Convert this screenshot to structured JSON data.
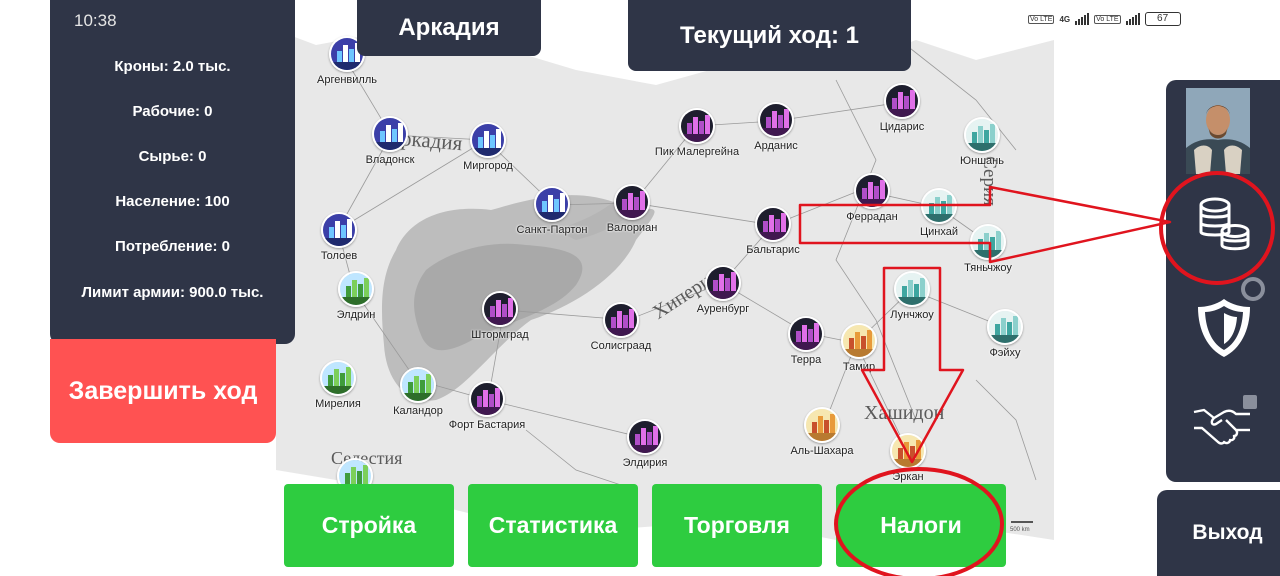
{
  "status_bar": {
    "time": "10:38",
    "sim1_label": "Vo LTE",
    "network": "4G",
    "sim2_label": "Vo LTE",
    "battery": "67"
  },
  "stats": {
    "crowns": "Кроны: 2.0 тыс.",
    "workers": "Рабочие: 0",
    "raw": "Сырье: 0",
    "population": "Население: 100",
    "consumption": "Потребление: 0",
    "army_limit": "Лимит армии: 900.0 тыс."
  },
  "end_turn_label": "Завершить ход",
  "country_name": "Аркадия",
  "turn_label": "Текущий ход: 1",
  "exit_label": "Выход",
  "bottom_buttons": {
    "build": "Стройка",
    "stats": "Статистика",
    "trade": "Торговля",
    "taxes": "Налоги"
  },
  "side_panel": {
    "avatar_icon": "leader-portrait",
    "finance_icon": "coins-stack-icon",
    "defense_icon": "shield-icon",
    "diplomacy_icon": "handshake-icon"
  },
  "regions": {
    "arcadia": "Аркадия",
    "hyperion": "Хиперион",
    "hashidon": "Хашидон",
    "selestia": "Селестия",
    "seria": "Серия"
  },
  "scale_label": "500 km",
  "cities": [
    {
      "name": "Аргенвилль",
      "style": "blue"
    },
    {
      "name": "Владонск",
      "style": "blue"
    },
    {
      "name": "Миргород",
      "style": "blue"
    },
    {
      "name": "Толоев",
      "style": "blue"
    },
    {
      "name": "Санкт-Партон",
      "style": "blue"
    },
    {
      "name": "Валориан",
      "style": "purple"
    },
    {
      "name": "Пик Малергейна",
      "style": "purple"
    },
    {
      "name": "Арданис",
      "style": "purple"
    },
    {
      "name": "Цидарис",
      "style": "purple"
    },
    {
      "name": "Юншань",
      "style": "teal"
    },
    {
      "name": "Феррадан",
      "style": "purple"
    },
    {
      "name": "Цинхай",
      "style": "teal"
    },
    {
      "name": "Бальтарис",
      "style": "purple"
    },
    {
      "name": "Тяньчжоу",
      "style": "teal"
    },
    {
      "name": "Элдрин",
      "style": "green"
    },
    {
      "name": "Штормград",
      "style": "purple"
    },
    {
      "name": "Солисграад",
      "style": "purple"
    },
    {
      "name": "Ауренбург",
      "style": "purple"
    },
    {
      "name": "Лунчжоу",
      "style": "teal"
    },
    {
      "name": "Фэйху",
      "style": "teal"
    },
    {
      "name": "Терра",
      "style": "purple"
    },
    {
      "name": "Тамир",
      "style": "desert"
    },
    {
      "name": "Мирелия",
      "style": "green"
    },
    {
      "name": "Каландор",
      "style": "green"
    },
    {
      "name": "Форт Бастария",
      "style": "purple"
    },
    {
      "name": "Элдирия",
      "style": "purple"
    },
    {
      "name": "Аль-Шахара",
      "style": "desert"
    },
    {
      "name": "Эркан",
      "style": "desert"
    },
    {
      "name": "Селестия",
      "style": "green"
    }
  ],
  "colors": {
    "panel": "#2f3547",
    "end_turn": "#ff5252",
    "action": "#2ecc40",
    "annotation": "#e0141e"
  }
}
